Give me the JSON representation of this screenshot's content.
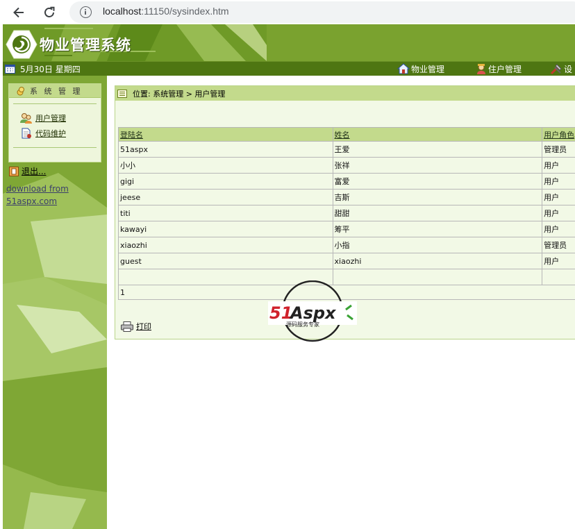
{
  "browser": {
    "url_host": "localhost",
    "url_rest": ":11150/sysindex.htm"
  },
  "header": {
    "app_title": "物业管理系统",
    "date": "5月30日 星期四",
    "menu": [
      {
        "label": "物业管理",
        "icon": "house-icon"
      },
      {
        "label": "住户管理",
        "icon": "person-icon"
      },
      {
        "label": "设",
        "icon": "tools-icon"
      }
    ]
  },
  "sidebar": {
    "panel_title": "系 统 管 理",
    "items": [
      {
        "label": "用户管理",
        "icon": "users-icon"
      },
      {
        "label": "代码维护",
        "icon": "document-icon"
      }
    ],
    "logout": "退出...",
    "download_line1": "download from",
    "download_line2": "51aspx.com"
  },
  "main": {
    "location": "位置: 系统管理 > 用户管理",
    "table": {
      "headers": [
        "登陆名",
        "姓名",
        "用户角色"
      ],
      "rows": [
        [
          "51aspx",
          "王爱",
          "管理员"
        ],
        [
          "小小",
          "张祥",
          "用户"
        ],
        [
          "gigi",
          "富爱",
          "用户"
        ],
        [
          "jeese",
          "吉斯",
          "用户"
        ],
        [
          "titi",
          "甜甜",
          "用户"
        ],
        [
          "kawayi",
          "筹平",
          "用户"
        ],
        [
          "xiaozhi",
          "小指",
          "管理员"
        ],
        [
          "guest",
          "xiaozhi",
          "用户"
        ]
      ],
      "pager": "1"
    },
    "print_label": "打印"
  },
  "watermark": {
    "brand_red": "51",
    "brand_dark": "Aspx",
    "tagline": "源码服务专家"
  },
  "colors": {
    "banner": "#7aa22f",
    "topbar": "#4e7612",
    "header_cell": "#c3da8c",
    "row_bg": "#f2f9e6"
  }
}
